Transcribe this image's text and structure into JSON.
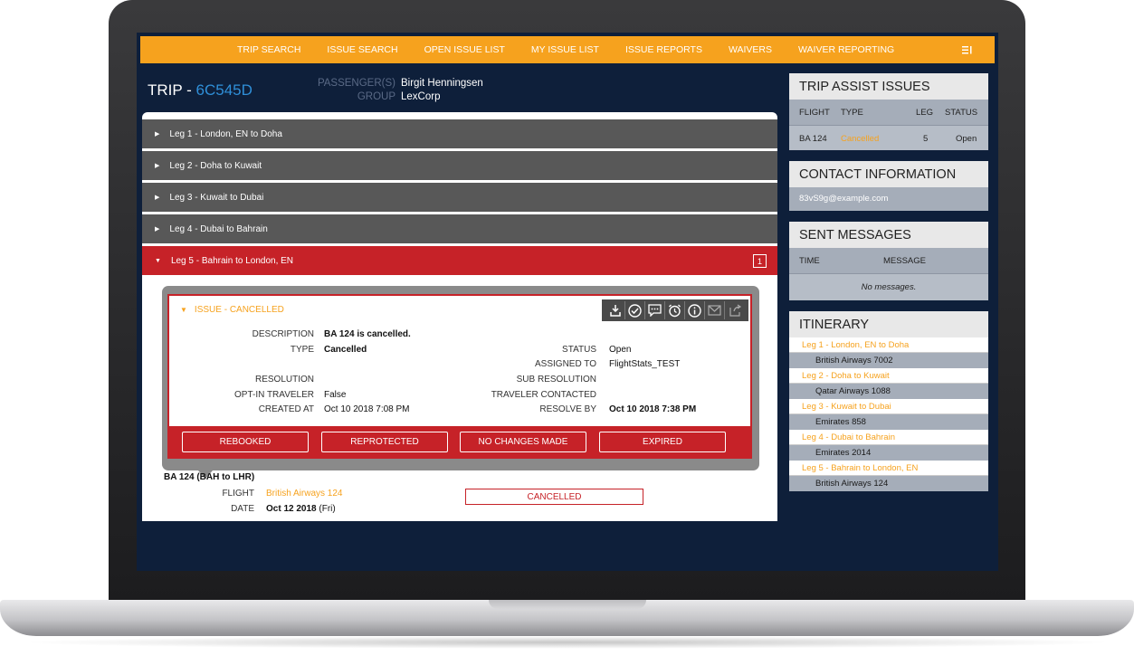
{
  "nav": {
    "items": [
      "TRIP SEARCH",
      "ISSUE SEARCH",
      "OPEN ISSUE LIST",
      "MY ISSUE LIST",
      "ISSUE REPORTS",
      "WAIVERS",
      "WAIVER REPORTING"
    ],
    "menu_icon": "menu-icon"
  },
  "trip": {
    "label": "TRIP - ",
    "code": "6C545D",
    "passenger_label": "PASSENGER(S)",
    "passenger_value": "Birgit Henningsen",
    "group_label": "GROUP",
    "group_value": "LexCorp"
  },
  "legs": [
    {
      "label": "Leg 1 - London, EN to Doha"
    },
    {
      "label": "Leg 2 - Doha to Kuwait"
    },
    {
      "label": "Leg 3 - Kuwait to Dubai"
    },
    {
      "label": "Leg 4 - Dubai to Bahrain"
    },
    {
      "label": "Leg 5 - Bahrain to London, EN",
      "badge": "1"
    }
  ],
  "issue": {
    "title": "ISSUE - CANCELLED",
    "toolbar_icons": [
      "download-icon",
      "check-circle-icon",
      "comment-icon",
      "alarm-clock-icon",
      "info-icon",
      "envelope-icon",
      "share-icon"
    ],
    "description_label": "DESCRIPTION",
    "description_value": "BA 124 is cancelled.",
    "type_label": "TYPE",
    "type_value": "Cancelled",
    "status_label": "STATUS",
    "status_value": "Open",
    "assigned_label": "ASSIGNED TO",
    "assigned_value": "FlightStats_TEST",
    "resolution_label": "RESOLUTION",
    "sub_resolution_label": "SUB RESOLUTION",
    "optin_label": "OPT-IN TRAVELER",
    "optin_value": "False",
    "contacted_label": "TRAVELER CONTACTED",
    "created_label": "CREATED AT",
    "created_value": "Oct 10 2018 7:08 PM",
    "resolve_label": "RESOLVE BY",
    "resolve_value": "Oct 10 2018 7:38 PM",
    "actions": [
      "REBOOKED",
      "REPROTECTED",
      "NO CHANGES MADE",
      "EXPIRED"
    ]
  },
  "flight": {
    "heading": "BA 124 (BAH to LHR)",
    "flight_label": "FLIGHT",
    "flight_value": "British Airways 124",
    "date_label": "DATE",
    "date_value": "Oct 12 2018",
    "date_day": " (Fri)",
    "status": "CANCELLED"
  },
  "trip_assist": {
    "title": "TRIP ASSIST ISSUES",
    "headers": {
      "flight": "FLIGHT",
      "type": "TYPE",
      "leg": "LEG",
      "status": "STATUS"
    },
    "rows": [
      {
        "flight": "BA 124",
        "type": "Cancelled",
        "leg": "5",
        "status": "Open"
      }
    ]
  },
  "contact": {
    "title": "CONTACT INFORMATION",
    "email": "83vS9g@example.com"
  },
  "messages": {
    "title": "SENT MESSAGES",
    "time_header": "TIME",
    "message_header": "MESSAGE",
    "empty": "No messages."
  },
  "itinerary": {
    "title": "ITINERARY",
    "legs": [
      {
        "leg": "Leg 1 - London, EN to Doha",
        "flight": "British Airways 7002"
      },
      {
        "leg": "Leg 2 - Doha to Kuwait",
        "flight": "Qatar Airways 1088"
      },
      {
        "leg": "Leg 3 - Kuwait to Dubai",
        "flight": "Emirates 858"
      },
      {
        "leg": "Leg 4 - Dubai to Bahrain",
        "flight": "Emirates 2014"
      },
      {
        "leg": "Leg 5 - Bahrain to London, EN",
        "flight": "British Airways 124"
      }
    ]
  },
  "colors": {
    "accent_orange": "#f6a21e",
    "alert_red": "#c62228",
    "navy_background": "#0e1f3a",
    "link_blue": "#2f8fd8"
  }
}
